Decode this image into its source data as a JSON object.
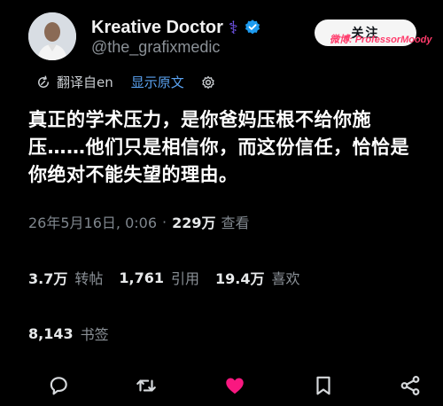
{
  "author": {
    "display_name": "Kreative Doctor",
    "badge_glyph": "⚕",
    "handle": "@the_grafixmedic",
    "verified": true
  },
  "follow": {
    "label": "关注"
  },
  "watermark": {
    "text": "微博: ProfessorMoody"
  },
  "translation": {
    "translated_from": "翻译自en",
    "show_original": "显示原文"
  },
  "tweet": {
    "text": "真正的学术压力，是你爸妈压根不给你施压……他们只是相信你，而这份信任，恰恰是你绝对不能失望的理由。"
  },
  "meta": {
    "datetime": "26年5月16日, 0:06",
    "separator": "·",
    "views": "229万",
    "views_label": "查看"
  },
  "stats": {
    "retweets": "3.7万",
    "retweets_label": "转帖",
    "quotes": "1,761",
    "quotes_label": "引用",
    "likes": "19.4万",
    "likes_label": "喜欢",
    "bookmarks": "8,143",
    "bookmarks_label": "书签"
  },
  "actions": {
    "reply_icon": "reply-icon",
    "retweet_icon": "retweet-icon",
    "like_icon": "heart-icon",
    "bookmark_icon": "bookmark-icon",
    "share_icon": "share-icon"
  },
  "colors": {
    "background": "#000000",
    "text": "#e7e9ea",
    "muted": "#7f868d",
    "link": "#5aa2f0",
    "verified": "#1d9bf0",
    "liked": "#f91880",
    "badge": "#7c5cff",
    "watermark": "#ff3b6b"
  }
}
